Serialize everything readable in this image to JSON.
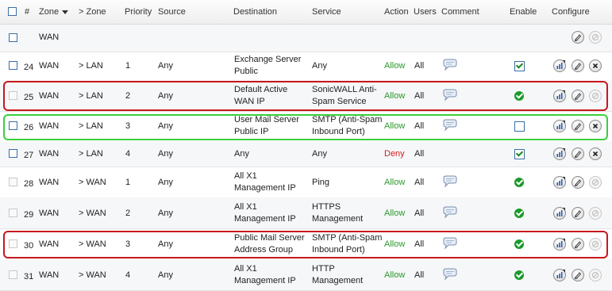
{
  "headers": {
    "num": "#",
    "zone_from": "Zone",
    "zone_to": "> Zone",
    "priority": "Priority",
    "source": "Source",
    "destination": "Destination",
    "service": "Service",
    "action": "Action",
    "users": "Users",
    "comment": "Comment",
    "enable": "Enable",
    "configure": "Configure"
  },
  "group_row": {
    "zone": "WAN"
  },
  "rows": [
    {
      "num": "24",
      "from": "WAN",
      "to": "> LAN",
      "priority": "1",
      "source": "Any",
      "dest1": "Exchange Server",
      "dest2": "Public",
      "svc1": "Any",
      "svc2": "",
      "action": "Allow",
      "users": "All"
    },
    {
      "num": "25",
      "from": "WAN",
      "to": "> LAN",
      "priority": "2",
      "source": "Any",
      "dest1": "Default Active",
      "dest2": "WAN IP",
      "svc1": "SonicWALL Anti-",
      "svc2": "Spam Service",
      "action": "Allow",
      "users": "All"
    },
    {
      "num": "26",
      "from": "WAN",
      "to": "> LAN",
      "priority": "3",
      "source": "Any",
      "dest1": "User Mail Server",
      "dest2": "Public IP",
      "svc1": "SMTP (Anti-Spam",
      "svc2": "Inbound Port)",
      "action": "Allow",
      "users": "All"
    },
    {
      "num": "27",
      "from": "WAN",
      "to": "> LAN",
      "priority": "4",
      "source": "Any",
      "dest1": "Any",
      "dest2": "",
      "svc1": "Any",
      "svc2": "",
      "action": "Deny",
      "users": "All"
    },
    {
      "num": "28",
      "from": "WAN",
      "to": "> WAN",
      "priority": "1",
      "source": "Any",
      "dest1": "All X1",
      "dest2": "Management IP",
      "svc1": "Ping",
      "svc2": "",
      "action": "Allow",
      "users": "All"
    },
    {
      "num": "29",
      "from": "WAN",
      "to": "> WAN",
      "priority": "2",
      "source": "Any",
      "dest1": "All X1",
      "dest2": "Management IP",
      "svc1": "HTTPS",
      "svc2": "Management",
      "action": "Allow",
      "users": "All"
    },
    {
      "num": "30",
      "from": "WAN",
      "to": "> WAN",
      "priority": "3",
      "source": "Any",
      "dest1": "Public Mail Server",
      "dest2": "Address Group",
      "svc1": "SMTP (Anti-Spam",
      "svc2": "Inbound Port)",
      "action": "Allow",
      "users": "All"
    },
    {
      "num": "31",
      "from": "WAN",
      "to": "> WAN",
      "priority": "4",
      "source": "Any",
      "dest1": "All X1",
      "dest2": "Management IP",
      "svc1": "HTTP",
      "svc2": "Management",
      "action": "Allow",
      "users": "All"
    }
  ],
  "colors": {
    "allow": "#2a9a2a",
    "deny": "#d02020",
    "highlight_red": "#c8171d",
    "highlight_green": "#3ccd3c"
  },
  "icons": [
    "comment-icon",
    "enabled-check-icon",
    "stats-icon",
    "edit-icon",
    "delete-icon"
  ]
}
